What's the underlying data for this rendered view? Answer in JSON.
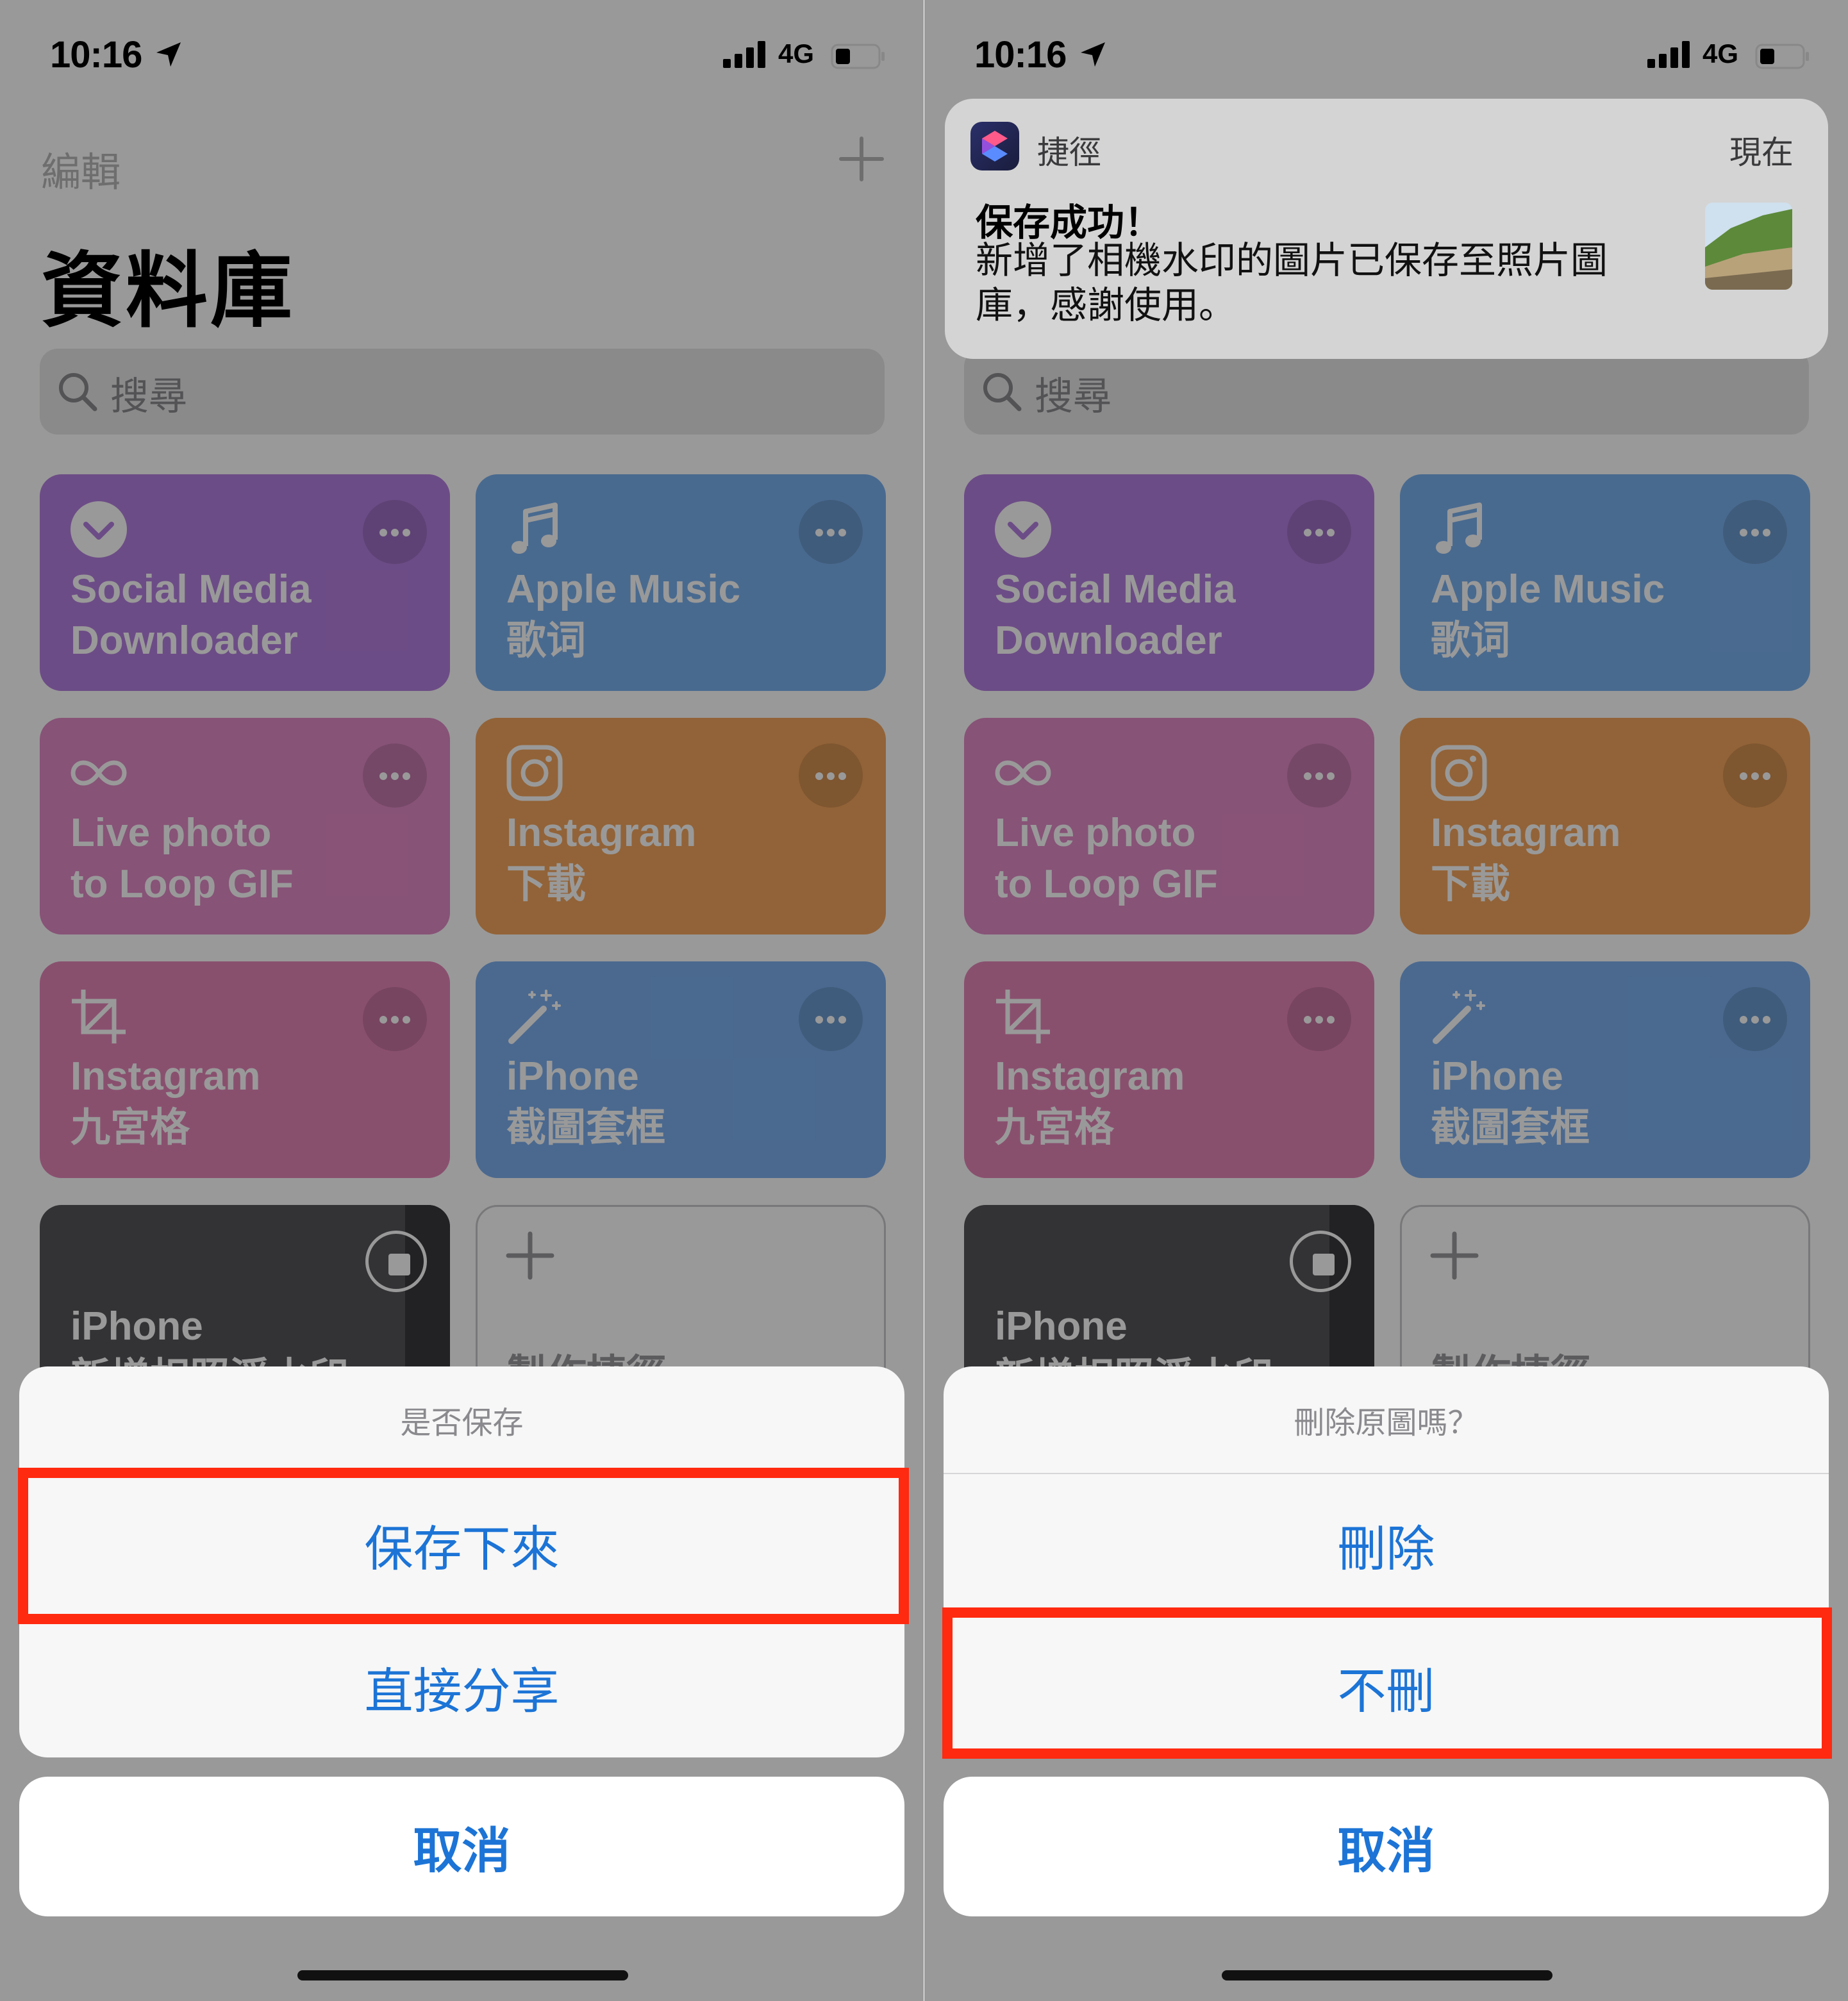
{
  "status_bar": {
    "time": "10:16",
    "network": "4G"
  },
  "library": {
    "edit_label": "編輯",
    "title": "資料庫",
    "search_placeholder": "搜尋",
    "tiles": [
      {
        "line1": "Social Media",
        "line2": "Downloader",
        "color": "#b57fe0",
        "icon": "chevron-down-circle-icon"
      },
      {
        "line1": "Apple Music",
        "line2": "歌词",
        "color": "#7bb1ee",
        "icon": "music-note-icon"
      },
      {
        "line1": "Live photo",
        "line2": "to Loop GIF",
        "color": "#e28ac6",
        "icon": "infinity-icon"
      },
      {
        "line1": "Instagram",
        "line2": "下載",
        "color": "#f3a55e",
        "icon": "instagram-icon"
      },
      {
        "line1": "Instagram",
        "line2": "九宮格",
        "color": "#e586b8",
        "icon": "crop-icon"
      },
      {
        "line1": "iPhone",
        "line2": "截圖套框",
        "color": "#7db0ee",
        "icon": "magic-wand-icon"
      },
      {
        "line1": "iPhone",
        "line2": "新增相照浮水印",
        "color": "#55555a",
        "icon": "stop-icon"
      },
      {
        "line1": "",
        "line2": "製作捷徑",
        "color": "#ffffff",
        "icon": "plus-icon"
      }
    ]
  },
  "left_sheet": {
    "title": "是否保存",
    "option1": "保存下來",
    "option2": "直接分享",
    "cancel": "取消"
  },
  "right_sheet": {
    "title": "刪除原圖嗎？",
    "option1": "刪除",
    "option2": "不刪",
    "cancel": "取消"
  },
  "notification": {
    "app_name": "捷徑",
    "time": "現在",
    "title": "保存成功！",
    "body_line1": "新增了相機水印的圖片已保存至照片圖",
    "body_line2": "庫，感謝使用。"
  },
  "colors": {
    "accent": "#1c74d6",
    "highlight": "#ff2a10"
  }
}
